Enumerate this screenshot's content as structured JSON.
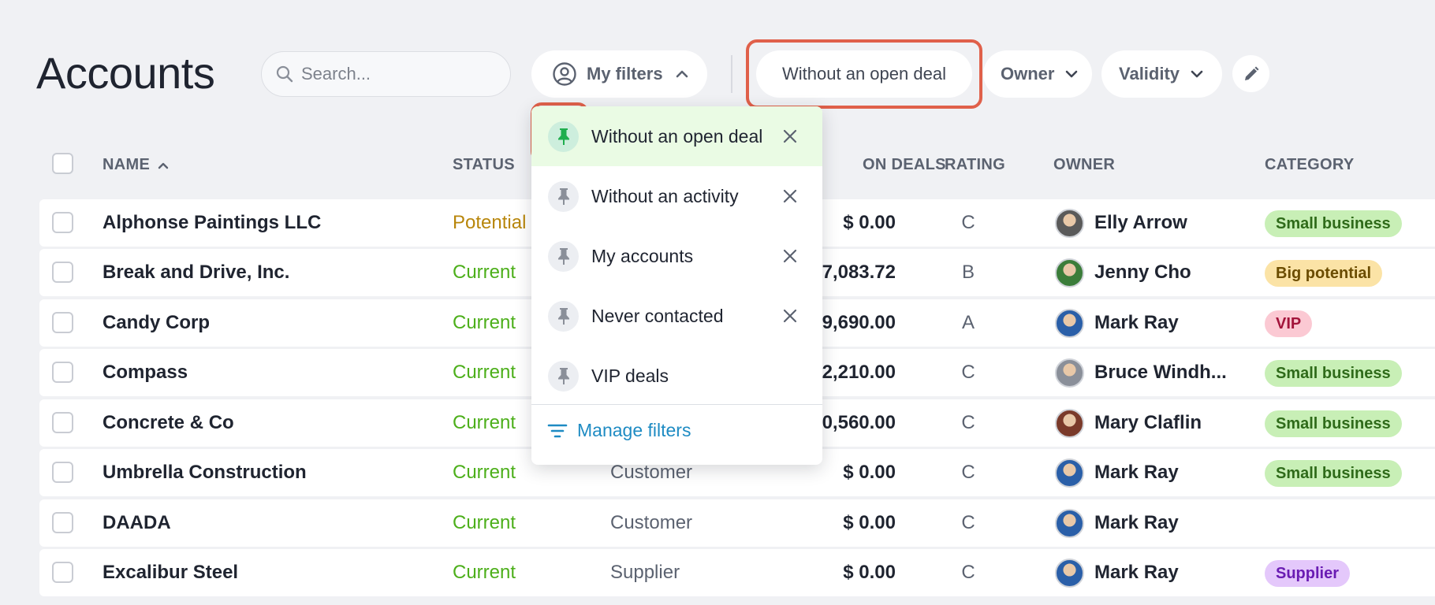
{
  "page": {
    "title": "Accounts"
  },
  "search": {
    "placeholder": "Search..."
  },
  "toolbar": {
    "my_filters_label": "My filters",
    "active_filter_label": "Without an open deal",
    "owner_label": "Owner",
    "validity_label": "Validity"
  },
  "columns": {
    "name": "NAME",
    "status": "STATUS",
    "open_deals": "ON DEALS",
    "rating": "RATING",
    "owner": "OWNER",
    "category": "CATEGORY"
  },
  "rows": [
    {
      "name": "Alphonse Paintings LLC",
      "status": "Potential",
      "type": "",
      "amount": "$ 0.00",
      "rating": "C",
      "owner": "Elly Arrow",
      "category": "Small business"
    },
    {
      "name": "Break and Drive, Inc.",
      "status": "Current",
      "type": "",
      "amount": "7,083.72",
      "rating": "B",
      "owner": "Jenny Cho",
      "category": "Big potential"
    },
    {
      "name": "Candy Corp",
      "status": "Current",
      "type": "",
      "amount": "9,690.00",
      "rating": "A",
      "owner": "Mark Ray",
      "category": "VIP"
    },
    {
      "name": "Compass",
      "status": "Current",
      "type": "",
      "amount": "2,210.00",
      "rating": "C",
      "owner": "Bruce Windh...",
      "category": "Small business"
    },
    {
      "name": "Concrete & Co",
      "status": "Current",
      "type": "",
      "amount": "0,560.00",
      "rating": "C",
      "owner": "Mary Claflin",
      "category": "Small business"
    },
    {
      "name": "Umbrella Construction",
      "status": "Current",
      "type": "Customer",
      "amount": "$ 0.00",
      "rating": "C",
      "owner": "Mark Ray",
      "category": "Small business"
    },
    {
      "name": "DAADA",
      "status": "Current",
      "type": "Customer",
      "amount": "$ 0.00",
      "rating": "C",
      "owner": "Mark Ray",
      "category": ""
    },
    {
      "name": "Excalibur Steel",
      "status": "Current",
      "type": "Supplier",
      "amount": "$ 0.00",
      "rating": "C",
      "owner": "Mark Ray",
      "category": "Supplier"
    }
  ],
  "dropdown": {
    "items": [
      {
        "label": "Without an open deal"
      },
      {
        "label": "Without an activity"
      },
      {
        "label": "My accounts"
      },
      {
        "label": "Never contacted"
      },
      {
        "label": "VIP deals"
      }
    ],
    "manage_label": "Manage filters"
  },
  "colors": {
    "status_potential": "#b8860b",
    "status_current": "#4caf1a",
    "badge_small_business_bg": "#c8efb6",
    "badge_small_business_fg": "#2f6b1a",
    "badge_big_potential_bg": "#fbe3a6",
    "badge_big_potential_fg": "#6b4c00",
    "badge_vip_bg": "#fbc9d3",
    "badge_vip_fg": "#a3143b",
    "badge_supplier_bg": "#e4c8fb",
    "badge_supplier_fg": "#6a1cb3",
    "highlight": "#e0604a",
    "link": "#1e8bc3"
  },
  "icons": {
    "search": "search-icon",
    "user_circle": "user-circle-icon",
    "chevron_up": "chevron-up-icon",
    "chevron_down": "chevron-down-icon",
    "pencil": "pencil-icon",
    "pin": "pin-icon",
    "close": "close-icon",
    "filter_lines": "filter-lines-icon",
    "sort_asc": "sort-asc-icon"
  }
}
